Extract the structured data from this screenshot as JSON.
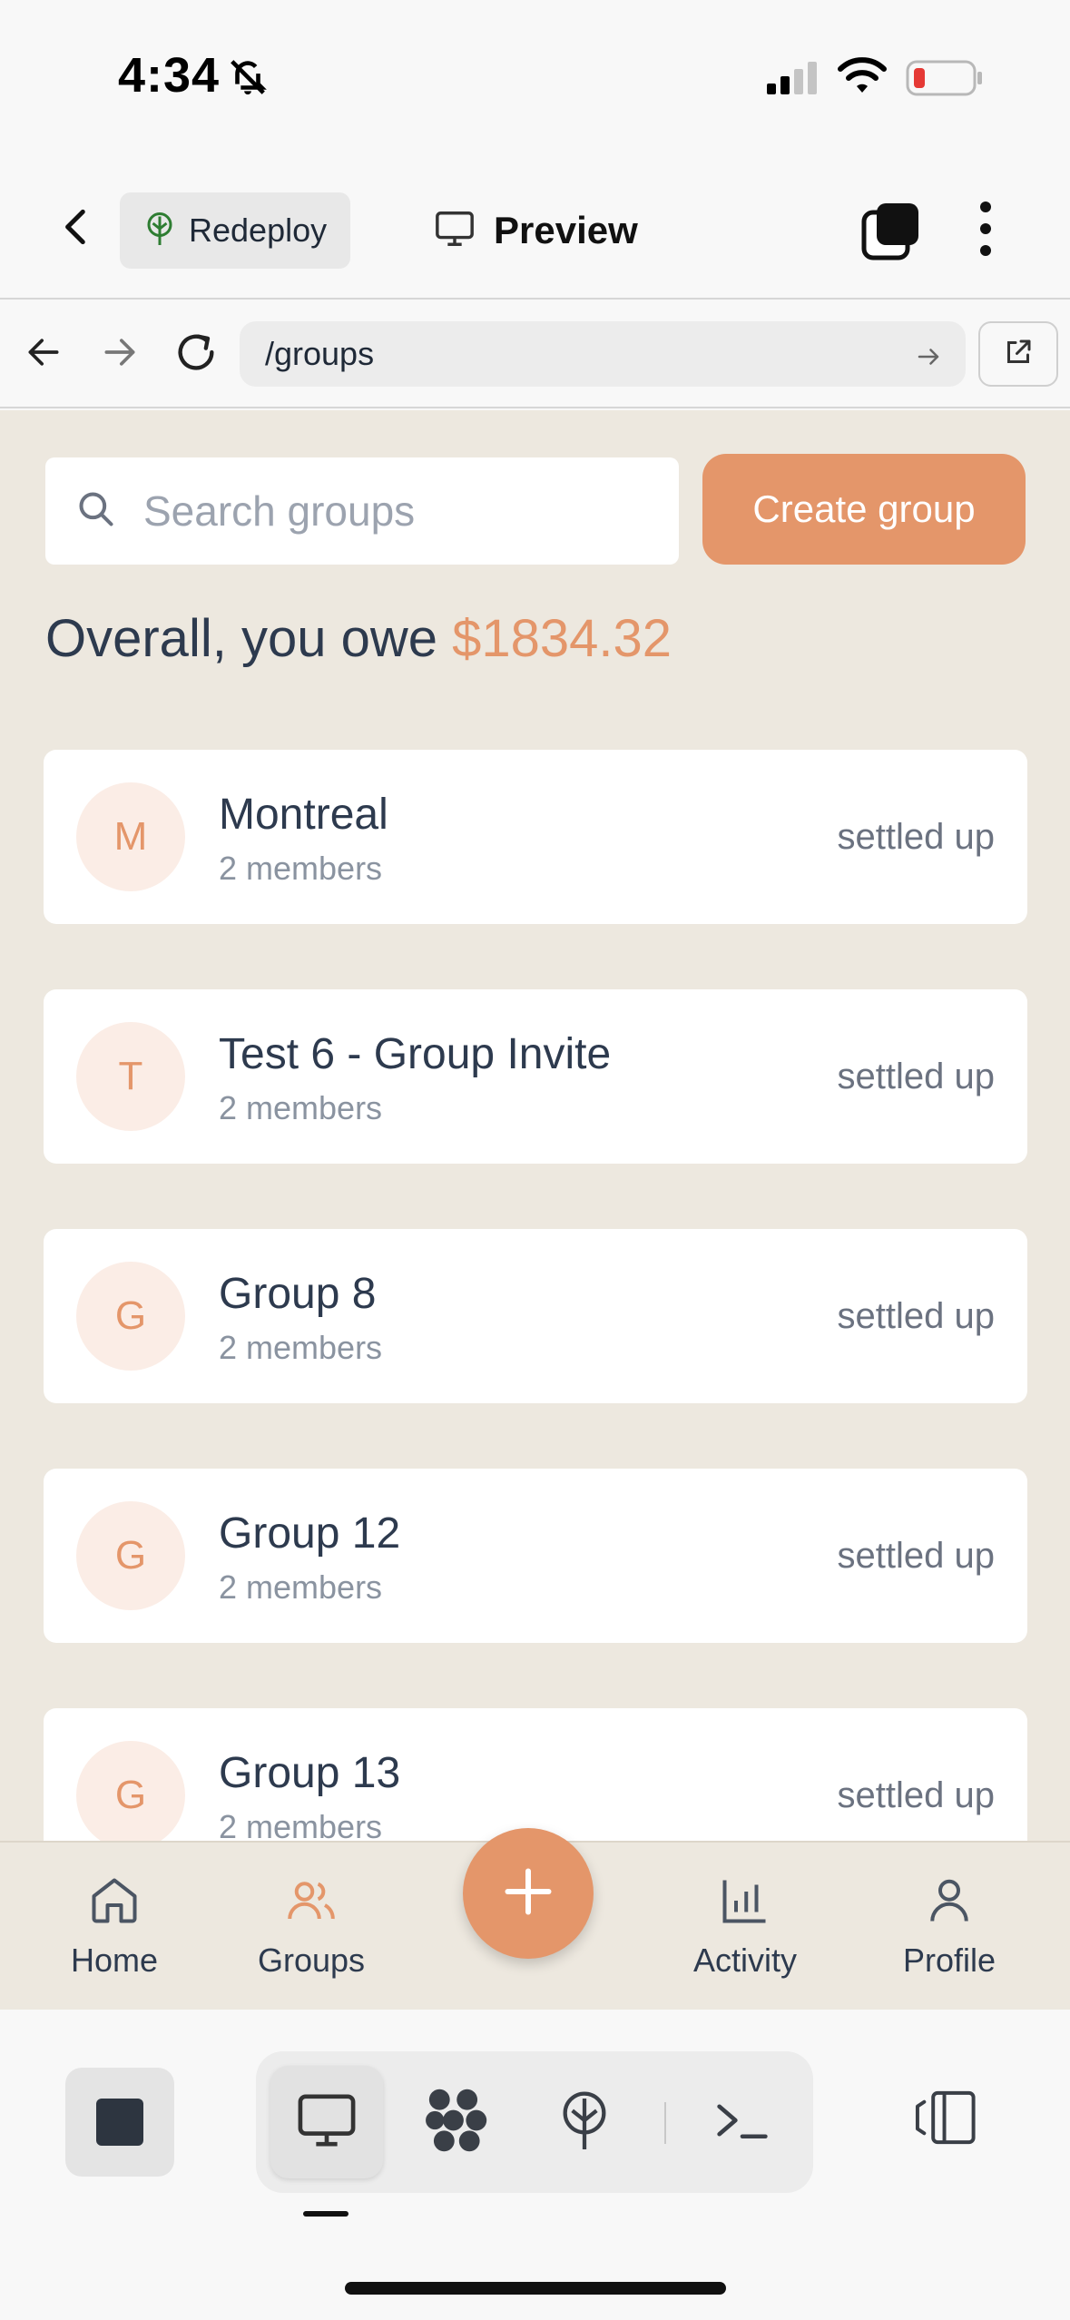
{
  "status_bar": {
    "time": "4:34",
    "icons": [
      "bell-slash-icon",
      "cellular-signal-icon",
      "wifi-icon",
      "battery-low-icon"
    ]
  },
  "toolbar": {
    "redeploy_label": "Redeploy",
    "preview_label": "Preview"
  },
  "browser": {
    "url": "/groups"
  },
  "page": {
    "search_placeholder": "Search groups",
    "create_group_label": "Create group",
    "overall_prefix": "Overall, you owe",
    "overall_amount": "$1834.32"
  },
  "groups": [
    {
      "initial": "M",
      "name": "Montreal",
      "members": "2 members",
      "status": "settled up"
    },
    {
      "initial": "T",
      "name": "Test 6 - Group Invite",
      "members": "2 members",
      "status": "settled up"
    },
    {
      "initial": "G",
      "name": "Group 8",
      "members": "2 members",
      "status": "settled up"
    },
    {
      "initial": "G",
      "name": "Group 12",
      "members": "2 members",
      "status": "settled up"
    },
    {
      "initial": "G",
      "name": "Group 13",
      "members": "2 members",
      "status": "settled up"
    }
  ],
  "bottom_nav": {
    "home": "Home",
    "groups": "Groups",
    "activity": "Activity",
    "profile": "Profile"
  },
  "colors": {
    "accent": "#e4966a",
    "background": "#ede8df",
    "text": "#2d3a4e"
  }
}
